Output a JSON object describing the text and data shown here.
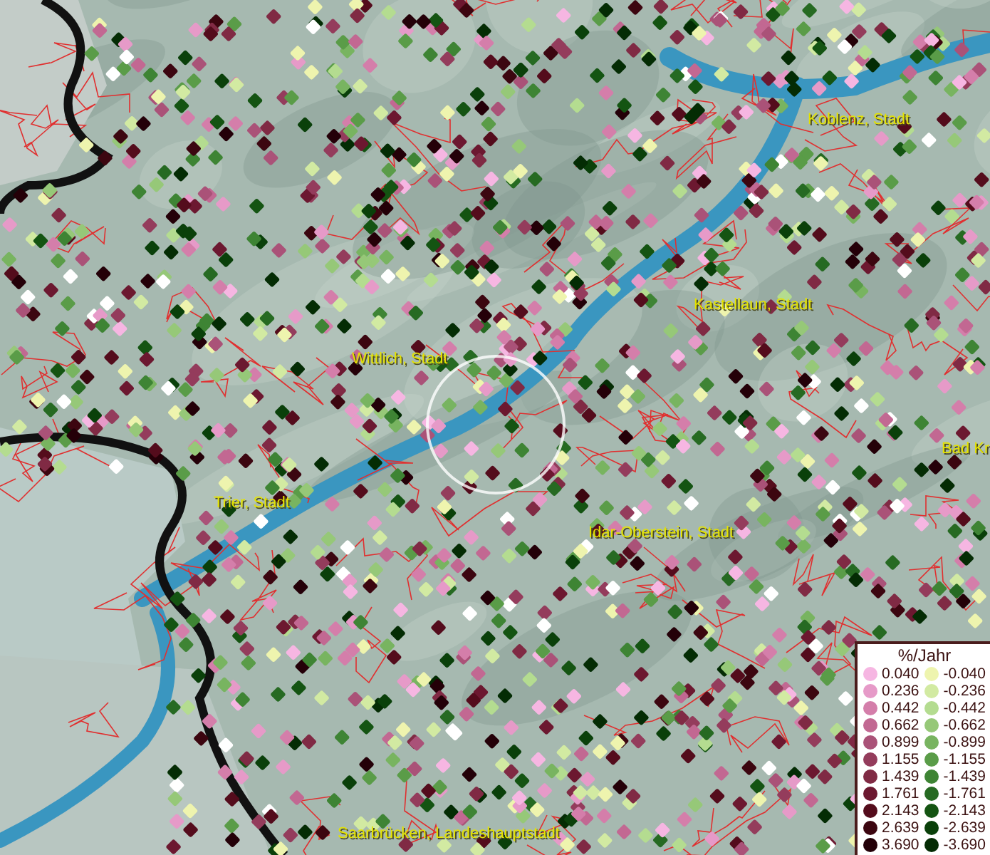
{
  "map": {
    "place_labels": [
      {
        "text": "Koblenz, Stadt"
      },
      {
        "text": "Kastellaun, Stadt"
      },
      {
        "text": "Wittlich, Stadt"
      },
      {
        "text": "Bad Kr"
      },
      {
        "text": "Trier, Stadt"
      },
      {
        "text": "Idar-Oberstein, Stadt"
      },
      {
        "text": "Saarbrücken, Landeshauptstadt"
      }
    ]
  },
  "legend": {
    "title": "%/Jahr",
    "rows": [
      {
        "positive": {
          "label": "0.040",
          "color": "#f6b6e2"
        },
        "negative": {
          "label": "-0.040",
          "color": "#eef4ae"
        }
      },
      {
        "positive": {
          "label": "0.236",
          "color": "#e69ac8"
        },
        "negative": {
          "label": "-0.236",
          "color": "#d2eaa2"
        }
      },
      {
        "positive": {
          "label": "0.442",
          "color": "#d47eaa"
        },
        "negative": {
          "label": "-0.442",
          "color": "#b4dc90"
        }
      },
      {
        "positive": {
          "label": "0.662",
          "color": "#c26892"
        },
        "negative": {
          "label": "-0.662",
          "color": "#96c878"
        }
      },
      {
        "positive": {
          "label": "0.899",
          "color": "#aa5278"
        },
        "negative": {
          "label": "-0.899",
          "color": "#78b460"
        }
      },
      {
        "positive": {
          "label": "1.155",
          "color": "#943c5c"
        },
        "negative": {
          "label": "-1.155",
          "color": "#5a9c48"
        }
      },
      {
        "positive": {
          "label": "1.439",
          "color": "#802a44"
        },
        "negative": {
          "label": "-1.439",
          "color": "#3e8434"
        }
      },
      {
        "positive": {
          "label": "1.761",
          "color": "#6c1830"
        },
        "negative": {
          "label": "-1.761",
          "color": "#266a22"
        }
      },
      {
        "positive": {
          "label": "2.143",
          "color": "#540c1c"
        },
        "negative": {
          "label": "-2.143",
          "color": "#145412"
        }
      },
      {
        "positive": {
          "label": "2.639",
          "color": "#3c0610"
        },
        "negative": {
          "label": "-2.639",
          "color": "#0a400a"
        }
      },
      {
        "positive": {
          "label": "3.690",
          "color": "#240008"
        },
        "negative": {
          "label": "-3.690",
          "color": "#042c04"
        }
      }
    ]
  }
}
